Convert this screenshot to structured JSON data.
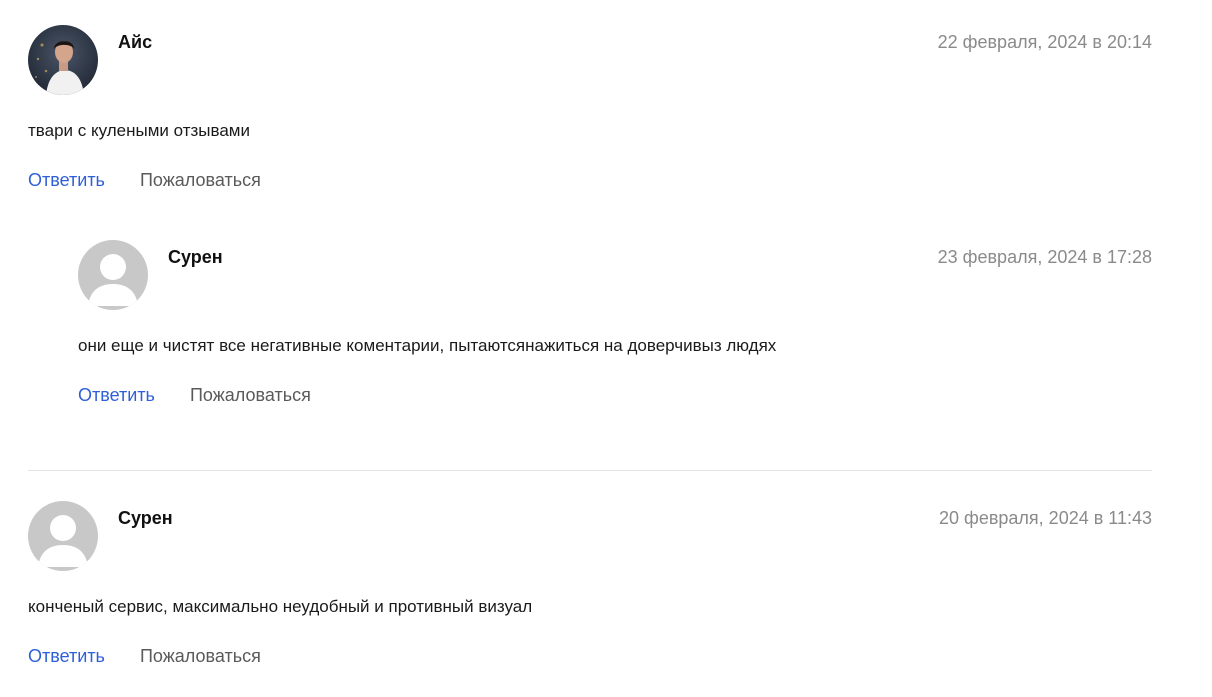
{
  "comments": [
    {
      "author": "Айс",
      "date": "22 февраля, 2024 в 20:14",
      "text": "твари с кулеными отзывами",
      "reply_label": "Ответить",
      "report_label": "Пожаловаться",
      "avatar": "user-photo"
    },
    {
      "author": "Сурен",
      "date": "23 февраля, 2024 в 17:28",
      "text": "они еще и чистят все негативные коментарии, пытаютсянажиться на доверчивыз людях",
      "reply_label": "Ответить",
      "report_label": "Пожаловаться",
      "avatar": "default-user-icon"
    },
    {
      "author": "Сурен",
      "date": "20 февраля, 2024 в 11:43",
      "text": "конченый сервис, максимально неудобный и противный визуал",
      "reply_label": "Ответить",
      "report_label": "Пожаловаться",
      "avatar": "default-user-icon"
    }
  ],
  "colors": {
    "link_blue": "#2f5fd8",
    "date_gray": "#8a8a8a",
    "divider": "#e3e3e3",
    "default_avatar": "#c8c8c8"
  }
}
